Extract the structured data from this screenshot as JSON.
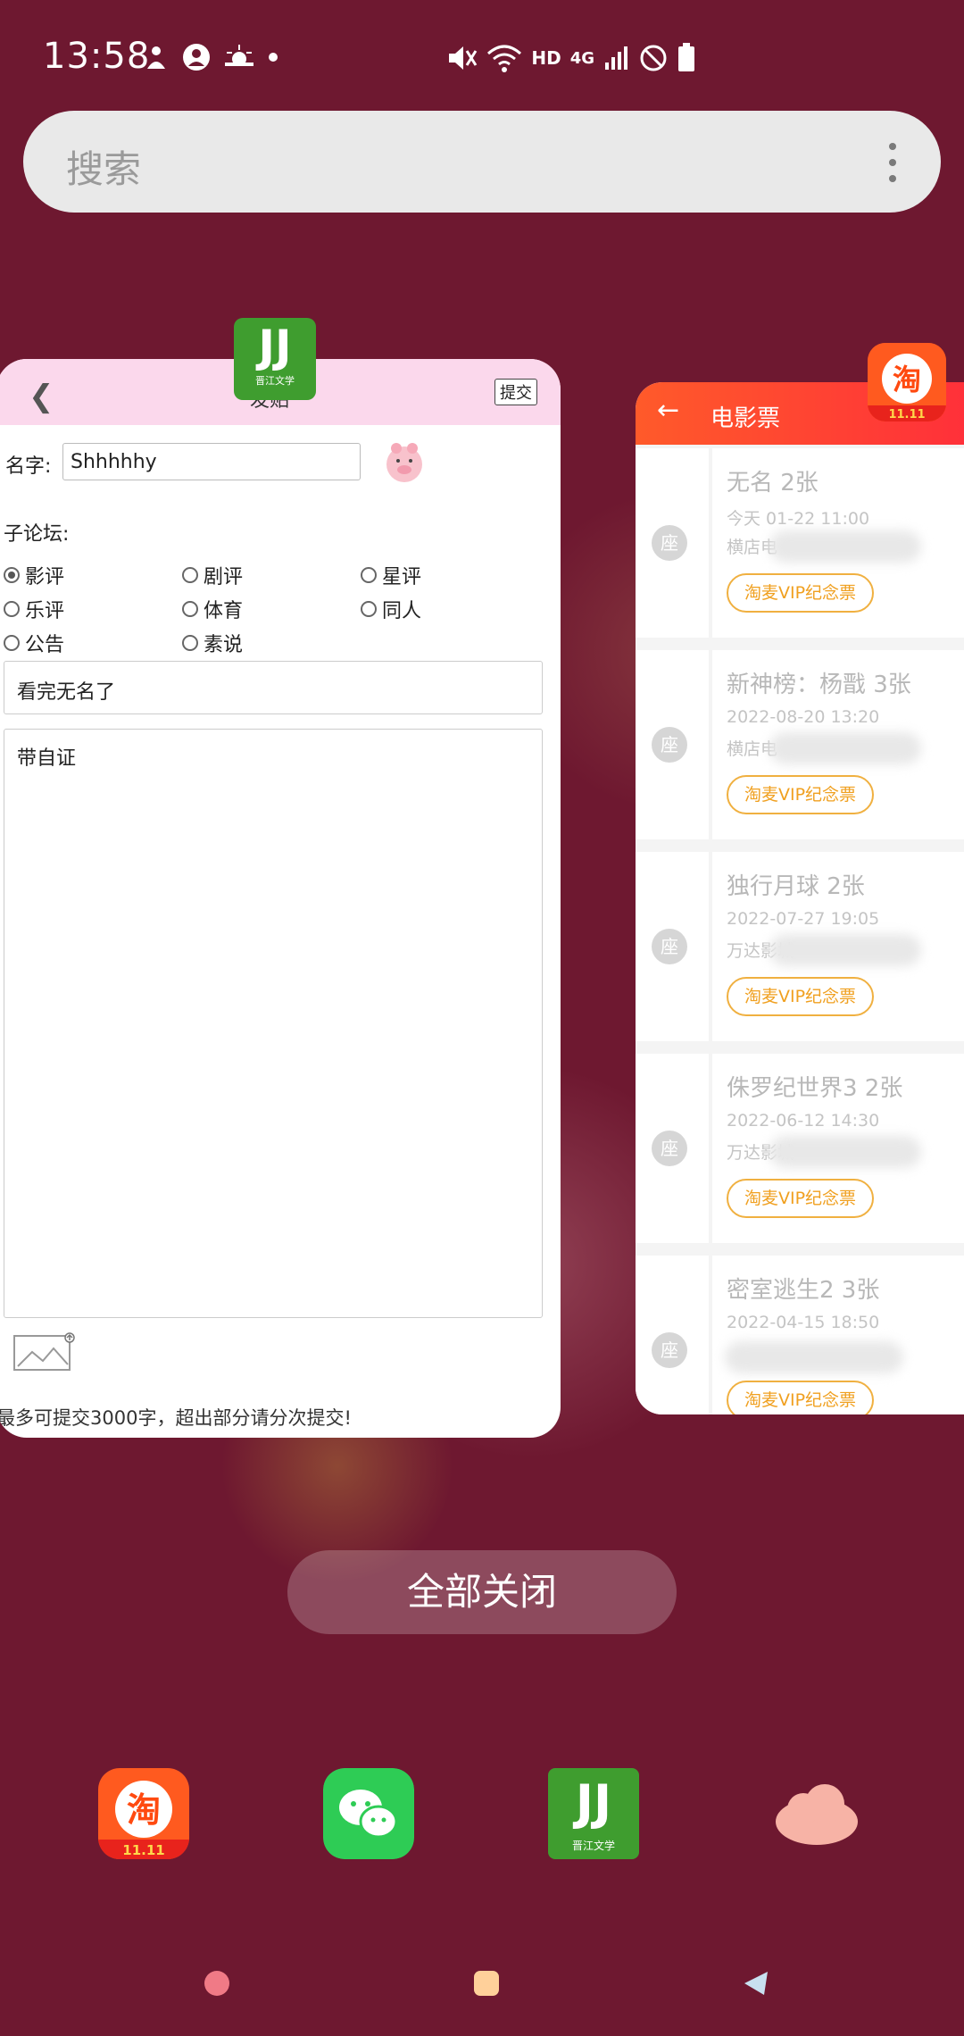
{
  "status_bar": {
    "time": "13:58",
    "left_icons": [
      "settings-person-icon",
      "account-icon",
      "weather-icon",
      "dot-icon"
    ],
    "right_icons": [
      "mute-icon",
      "wifi-icon",
      "hd-icon",
      "4g-icon",
      "signal-icon",
      "no-disturb-icon",
      "battery-icon"
    ],
    "hd_label": "HD",
    "network_label": "4G"
  },
  "search": {
    "placeholder": "搜索"
  },
  "left_card": {
    "app_name": "晋江文学",
    "header": {
      "title": "发贴",
      "submit": "提交"
    },
    "name_label": "名字:",
    "name_value": "Shhhhhy",
    "subforum_label": "子论坛:",
    "options": [
      {
        "label": "影评",
        "checked": true
      },
      {
        "label": "剧评",
        "checked": false
      },
      {
        "label": "星评",
        "checked": false
      },
      {
        "label": "乐评",
        "checked": false
      },
      {
        "label": "体育",
        "checked": false
      },
      {
        "label": "同人",
        "checked": false
      },
      {
        "label": "公告",
        "checked": false
      },
      {
        "label": "素说",
        "checked": false
      }
    ],
    "title_value": "看完无名了",
    "body_value": "带自证",
    "footer_note": "最多可提交3000字，超出部分请分次提交!"
  },
  "right_card": {
    "header_title": "电影票",
    "seat_label": "座",
    "tickets": [
      {
        "title": "无名 2张",
        "time": "今天 01-22 11:00",
        "cinema": "横店电",
        "button": "淘麦VIP纪念票"
      },
      {
        "title": "新神榜：杨戬 3张",
        "time": "2022-08-20 13:20",
        "cinema": "横店电",
        "button": "淘麦VIP纪念票"
      },
      {
        "title": "独行月球 2张",
        "time": "2022-07-27 19:05",
        "cinema": "万达影城",
        "button": "淘麦VIP纪念票"
      },
      {
        "title": "侏罗纪世界3 2张",
        "time": "2022-06-12 14:30",
        "cinema": "万达影城",
        "button": "淘麦VIP纪念票"
      },
      {
        "title": "密室逃生2 3张",
        "time": "2022-04-15 18:50",
        "cinema": "",
        "button": "淘麦VIP纪念票"
      }
    ]
  },
  "close_all": "全部关闭",
  "dock": [
    "taobao-icon",
    "wechat-icon",
    "jinjiang-icon",
    "cloud-icon"
  ],
  "colors": {
    "background": "#6e1830",
    "accent": "#ff4a2f",
    "ticket_button": "#f0a020"
  }
}
